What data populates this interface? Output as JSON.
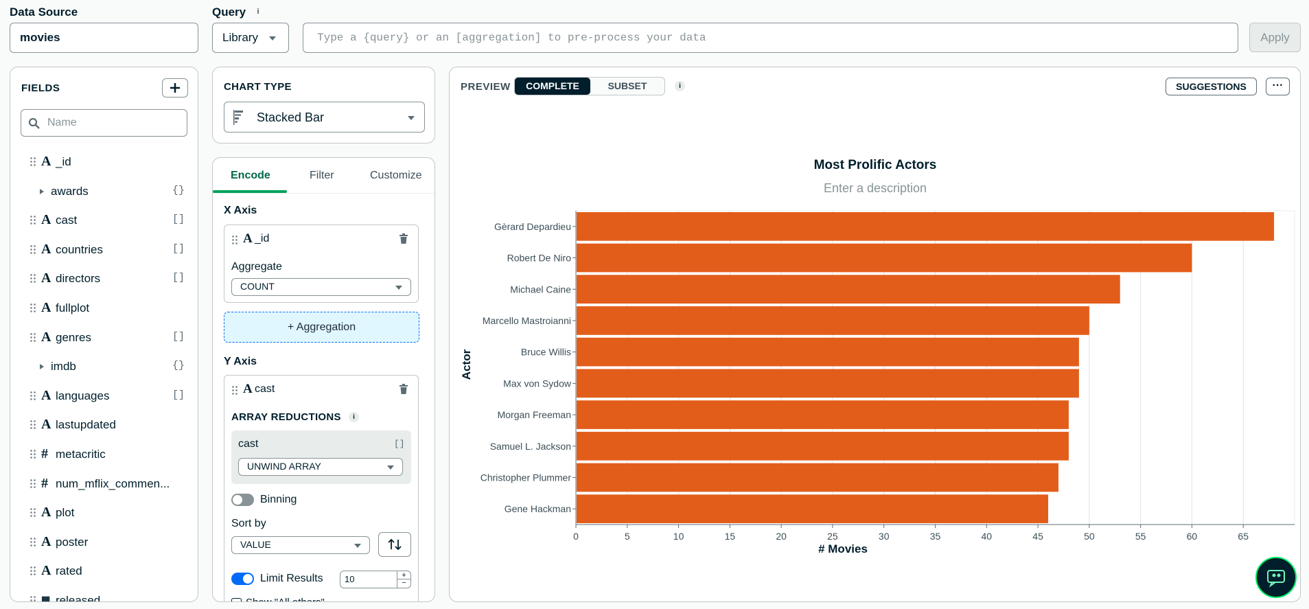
{
  "data_source": {
    "label": "Data Source",
    "value": "movies"
  },
  "query": {
    "label": "Query",
    "info_icon": "info-icon",
    "library_label": "Library",
    "placeholder": "Type a {query} or an [aggregation] to pre-process your data",
    "apply_label": "Apply"
  },
  "fields_panel": {
    "title": "FIELDS",
    "search_placeholder": "Name",
    "items": [
      {
        "name": "_id",
        "type": "A",
        "tag": ""
      },
      {
        "name": "awards",
        "type": "object",
        "tag": "{}"
      },
      {
        "name": "cast",
        "type": "A",
        "tag": "[]"
      },
      {
        "name": "countries",
        "type": "A",
        "tag": "[]"
      },
      {
        "name": "directors",
        "type": "A",
        "tag": "[]"
      },
      {
        "name": "fullplot",
        "type": "A",
        "tag": ""
      },
      {
        "name": "genres",
        "type": "A",
        "tag": "[]"
      },
      {
        "name": "imdb",
        "type": "object",
        "tag": "{}"
      },
      {
        "name": "languages",
        "type": "A",
        "tag": "[]"
      },
      {
        "name": "lastupdated",
        "type": "A",
        "tag": ""
      },
      {
        "name": "metacritic",
        "type": "#",
        "tag": ""
      },
      {
        "name": "num_mflix_commen...",
        "type": "#",
        "tag": ""
      },
      {
        "name": "plot",
        "type": "A",
        "tag": ""
      },
      {
        "name": "poster",
        "type": "A",
        "tag": ""
      },
      {
        "name": "rated",
        "type": "A",
        "tag": ""
      },
      {
        "name": "released",
        "type": "date",
        "tag": ""
      }
    ]
  },
  "chart_type": {
    "label": "CHART TYPE",
    "value": "Stacked Bar"
  },
  "encode_panel": {
    "tabs": [
      "Encode",
      "Filter",
      "Customize"
    ],
    "active_tab": "Encode",
    "x_axis": {
      "label": "X Axis",
      "field": "_id",
      "aggregate_label": "Aggregate",
      "aggregate_value": "COUNT",
      "add_aggregation": "+ Aggregation"
    },
    "y_axis": {
      "label": "Y Axis",
      "field": "cast",
      "array_reductions_label": "ARRAY REDUCTIONS",
      "reduction_field": "cast",
      "reduction_tag": "[]",
      "reduction_value": "UNWIND ARRAY",
      "binning_label": "Binning",
      "binning_on": false,
      "sort_by_label": "Sort by",
      "sort_by_value": "VALUE",
      "limit_label": "Limit Results",
      "limit_on": true,
      "limit_value": "10",
      "show_all_others_label": "Show \"All others\""
    }
  },
  "preview": {
    "label": "PREVIEW",
    "toggle": [
      "COMPLETE",
      "SUBSET"
    ],
    "active": "COMPLETE",
    "suggestions_label": "SUGGESTIONS",
    "more_label": "···"
  },
  "colors": {
    "bar": "#e35d1a",
    "accent": "#00684a",
    "dark": "#001e2b"
  },
  "chart_data": {
    "type": "bar",
    "orientation": "horizontal",
    "title": "Most Prolific Actors",
    "subtitle": "Enter a description",
    "xlabel": "# Movies",
    "ylabel": "Actor",
    "categories": [
      "Gèrard Depardieu",
      "Robert De Niro",
      "Michael Caine",
      "Marcello Mastroianni",
      "Bruce Willis",
      "Max von Sydow",
      "Morgan Freeman",
      "Samuel L. Jackson",
      "Christopher Plummer",
      "Gene Hackman"
    ],
    "values": [
      68,
      60,
      53,
      50,
      49,
      49,
      48,
      48,
      47,
      46
    ],
    "xlim": [
      0,
      70
    ],
    "xticks": [
      0,
      5,
      10,
      15,
      20,
      25,
      30,
      35,
      40,
      45,
      50,
      55,
      60,
      65
    ],
    "grid": true
  }
}
